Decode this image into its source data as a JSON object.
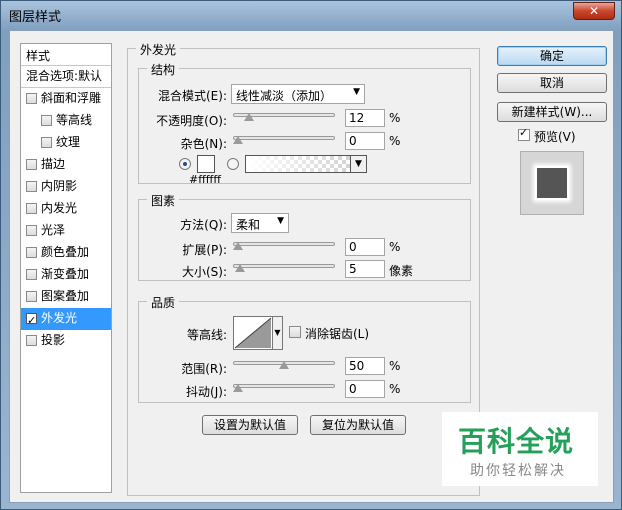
{
  "window": {
    "title": "图层样式",
    "close_label": "✕"
  },
  "styles_list": {
    "header": "样式",
    "blend_options": "混合选项:默认",
    "items": [
      {
        "label": "斜面和浮雕",
        "checked": false
      },
      {
        "label": "等高线",
        "checked": false,
        "sub": true
      },
      {
        "label": "纹理",
        "checked": false,
        "sub": true
      },
      {
        "label": "描边",
        "checked": false
      },
      {
        "label": "内阴影",
        "checked": false
      },
      {
        "label": "内发光",
        "checked": false
      },
      {
        "label": "光泽",
        "checked": false
      },
      {
        "label": "颜色叠加",
        "checked": false
      },
      {
        "label": "渐变叠加",
        "checked": false
      },
      {
        "label": "图案叠加",
        "checked": false
      },
      {
        "label": "外发光",
        "checked": true,
        "selected": true
      },
      {
        "label": "投影",
        "checked": false
      }
    ]
  },
  "outer_glow": {
    "title": "外发光",
    "structure": {
      "title": "结构",
      "blend_mode_label": "混合模式(E):",
      "blend_mode_value": "线性减淡（添加）",
      "opacity_label": "不透明度(O):",
      "opacity_value": "12",
      "opacity_fraction": 0.12,
      "noise_label": "杂色(N):",
      "noise_value": "0",
      "noise_fraction": 0,
      "color_hex": "#ffffff",
      "percent": "%"
    },
    "elements": {
      "title": "图素",
      "technique_label": "方法(Q):",
      "technique_value": "柔和",
      "spread_label": "扩展(P):",
      "spread_value": "0",
      "spread_fraction": 0,
      "size_label": "大小(S):",
      "size_value": "5",
      "size_fraction": 0.02,
      "size_unit": "像素",
      "percent": "%"
    },
    "quality": {
      "title": "品质",
      "contour_label": "等高线:",
      "antialias_label": "消除锯齿(L)",
      "antialias_checked": false,
      "range_label": "范围(R):",
      "range_value": "50",
      "range_fraction": 0.5,
      "jitter_label": "抖动(J):",
      "jitter_value": "0",
      "jitter_fraction": 0,
      "percent": "%"
    },
    "make_default": "设置为默认值",
    "reset_default": "复位为默认值"
  },
  "buttons": {
    "ok": "确定",
    "cancel": "取消",
    "new_style": "新建样式(W)...",
    "preview_label": "预览(V)",
    "preview_checked": true
  },
  "watermark": {
    "main": "百科全说",
    "sub": "助你轻松解决"
  }
}
